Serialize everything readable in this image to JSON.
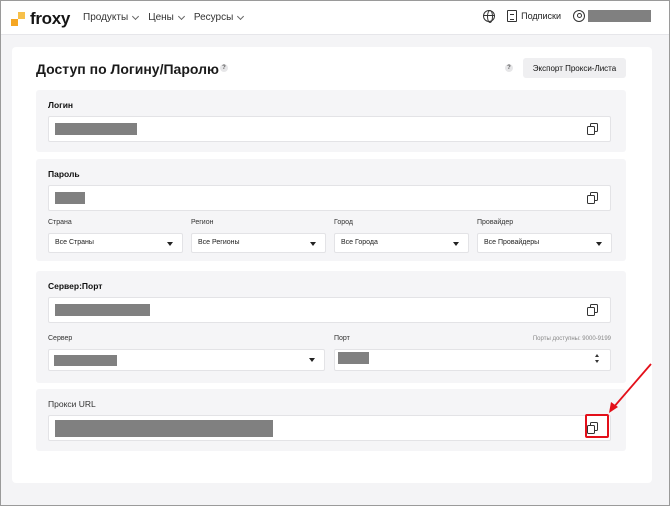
{
  "header": {
    "logo_text": "froxy",
    "nav": [
      "Продукты",
      "Цены",
      "Ресурсы"
    ],
    "subscriptions_label": "Подписки"
  },
  "page": {
    "title": "Доступ по Логину/Паролю",
    "help_mark": "?",
    "export_button": "Экспорт Прокси-Листа"
  },
  "login": {
    "label": "Логин"
  },
  "password": {
    "label": "Пароль"
  },
  "filters": {
    "country": {
      "label": "Страна",
      "value": "Все Страны"
    },
    "region": {
      "label": "Регион",
      "value": "Все Регионы"
    },
    "city": {
      "label": "Город",
      "value": "Все Города"
    },
    "provider": {
      "label": "Провайдер",
      "value": "Все Провайдеры"
    }
  },
  "server_port": {
    "label": "Сервер:Порт",
    "server_label": "Сервер",
    "port_label": "Порт",
    "ports_note": "Порты доступны: 9000-9199"
  },
  "proxy_url": {
    "label": "Прокси URL"
  },
  "colors": {
    "accent": "#f5a623",
    "annotation": "#e3101a"
  }
}
